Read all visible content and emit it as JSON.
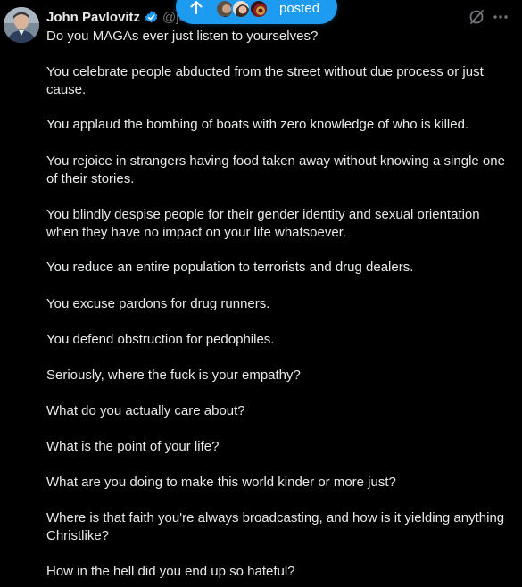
{
  "author": {
    "name": "John Pavlovitz",
    "handle": "@jo",
    "avatar_icon": "profile-photo",
    "verified_icon": "verified-badge-icon",
    "verified_color": "#1d9bf0"
  },
  "new_posts_pill": {
    "label": "posted",
    "arrow_icon": "arrow-up-icon",
    "color": "#1d9bf0"
  },
  "actions": {
    "grok_icon": "grok-icon",
    "more_icon": "more-options-icon"
  },
  "post": {
    "paragraphs": [
      "Do you MAGAs ever just listen to yourselves?",
      "You celebrate people abducted from the street without due process or just cause.",
      "You applaud the bombing of boats with zero knowledge of who is killed.",
      "You rejoice in strangers having food taken away without knowing a single one of their stories.",
      "You blindly despise people for their gender identity and sexual orientation when they have no impact on your life whatsoever.",
      "You reduce an entire population to terrorists and drug dealers.",
      "You excuse pardons for drug runners.",
      "You defend obstruction for pedophiles.",
      "Seriously, where the fuck is your empathy?",
      "What do you actually care about?",
      "What is the point of your life?",
      "What are you doing to make this world kinder or more just?",
      "Where is that faith you're always broadcasting, and how is it yielding anything Christlike?",
      "How in the hell did you end up so hateful?"
    ]
  },
  "colors": {
    "background": "#000000",
    "text": "#e7e9ea",
    "secondary_text": "#71767b",
    "accent": "#1d9bf0"
  }
}
